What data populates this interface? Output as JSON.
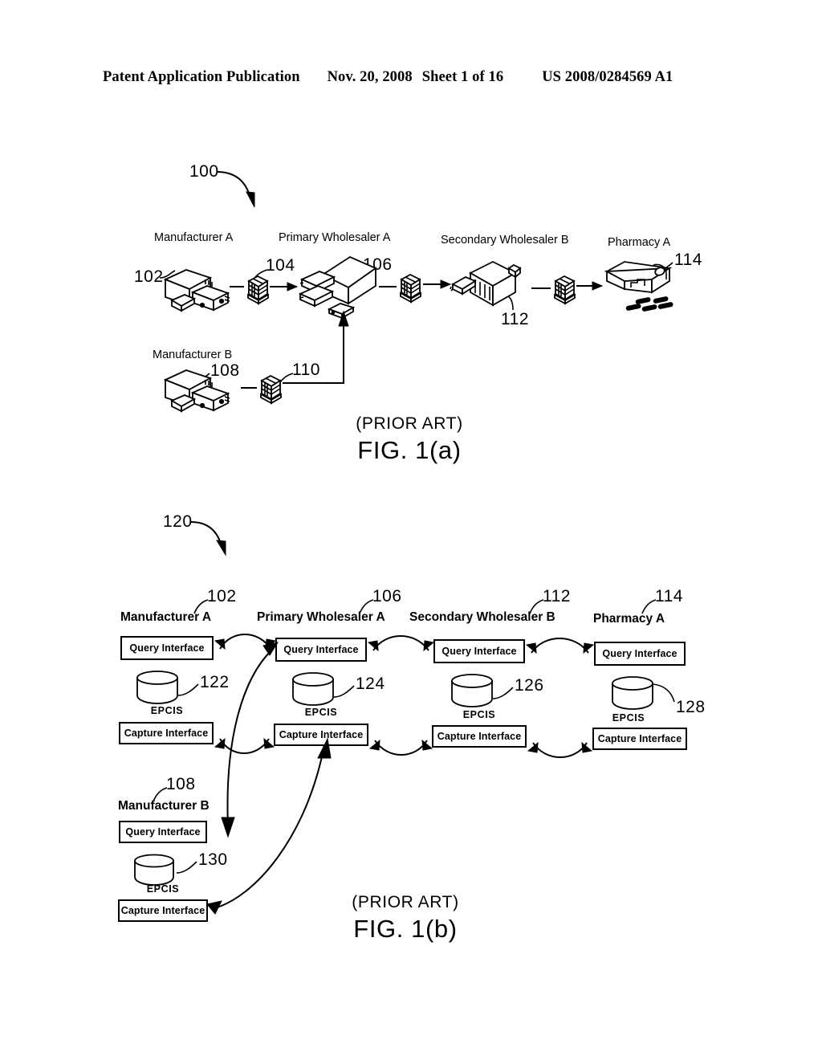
{
  "header": {
    "publication": "Patent Application Publication",
    "date": "Nov. 20, 2008",
    "sheet": "Sheet 1 of 16",
    "patent_number": "US 2008/0284569 A1"
  },
  "figure_a": {
    "figure_ref": "100",
    "caption_prior_art": "(PRIOR ART)",
    "caption_figure": "FIG. 1(a)",
    "nodes": [
      {
        "label": "Manufacturer A",
        "ref": "102",
        "icon": "factory-truck-icon"
      },
      {
        "label": "Primary Wholesaler A",
        "ref": "106",
        "icon": "warehouse-icon"
      },
      {
        "label": "Secondary Wholesaler B",
        "ref": "112",
        "icon": "warehouse-icon"
      },
      {
        "label": "Pharmacy A",
        "ref": "114",
        "icon": "pharmacy-icon"
      },
      {
        "label": "Manufacturer B",
        "ref": "108",
        "icon": "factory-truck-icon"
      }
    ],
    "pallets": [
      {
        "ref": "104"
      },
      {
        "ref": ""
      },
      {
        "ref": ""
      },
      {
        "ref": "110"
      }
    ]
  },
  "figure_b": {
    "figure_ref": "120",
    "caption_prior_art": "(PRIOR ART)",
    "caption_figure": "FIG. 1(b)",
    "query_interface_label": "Query Interface",
    "capture_interface_label": "Capture Interface",
    "epcis_label": "EPCIS",
    "columns": [
      {
        "label": "Manufacturer A",
        "ref": "102",
        "db_ref": "122"
      },
      {
        "label": "Primary Wholesaler A",
        "ref": "106",
        "db_ref": "124"
      },
      {
        "label": "Secondary Wholesaler B",
        "ref": "112",
        "db_ref": "126"
      },
      {
        "label": "Pharmacy A",
        "ref": "114",
        "db_ref": "128"
      }
    ],
    "lower_column": {
      "label": "Manufacturer B",
      "ref": "108",
      "db_ref": "130"
    }
  },
  "colors": {
    "ink": "#000000",
    "paper": "#ffffff"
  }
}
